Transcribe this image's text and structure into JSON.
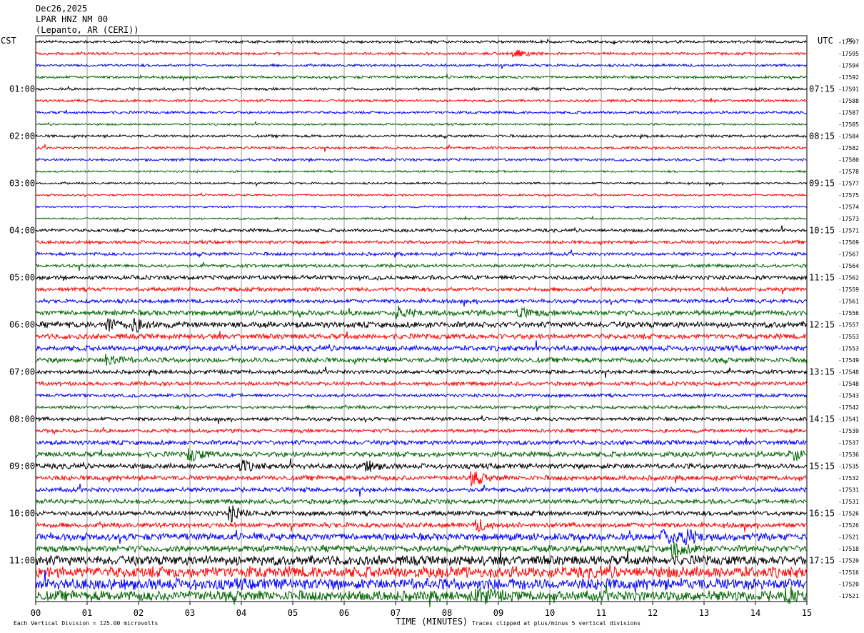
{
  "header": {
    "date": "Dec26,2025",
    "station": "LPAR HNZ NM 00",
    "location": "(Lepanto, AR (CERI))"
  },
  "left_zone": "CST",
  "right_zone": "UTC",
  "right_top_note": "DC",
  "footer": {
    "scale_note": "Each Vertical Division =  125.00 microvolts",
    "xlabel": "TIME (MINUTES)",
    "clip_note": "Traces clipped at plus/minus 5 vertical divisions"
  },
  "colors": [
    "#000000",
    "#ff0000",
    "#0000ff",
    "#006400"
  ],
  "chart_data": {
    "type": "line",
    "title": "",
    "xlabel": "TIME (MINUTES)",
    "x_ticks": [
      "00",
      "01",
      "02",
      "03",
      "04",
      "05",
      "06",
      "07",
      "08",
      "09",
      "10",
      "11",
      "12",
      "13",
      "14",
      "15"
    ],
    "xlim": [
      0,
      15
    ],
    "rows_per_hour": 4,
    "left_time_labels": [
      "01:00",
      "02:00",
      "03:00",
      "04:00",
      "05:00",
      "06:00",
      "07:00",
      "08:00",
      "09:00",
      "10:00",
      "11:00"
    ],
    "right_time_labels": [
      "07:15",
      "08:15",
      "09:15",
      "10:15",
      "11:15",
      "12:15",
      "13:15",
      "14:15",
      "15:15",
      "16:15",
      "17:15"
    ],
    "dc_offsets": [
      "-17597",
      "-17595",
      "-17594",
      "-17592",
      "-17591",
      "-17588",
      "-17587",
      "-17585",
      "-17584",
      "-17582",
      "-17580",
      "-17578",
      "-17577",
      "-17575",
      "-17574",
      "-17573",
      "-17571",
      "-17569",
      "-17567",
      "-17564",
      "-17562",
      "-17559",
      "-17561",
      "-17556",
      "-17557",
      "-17553",
      "-17553",
      "-17549",
      "-17548",
      "-17548",
      "-17543",
      "-17542",
      "-17541",
      "-17539",
      "-17537",
      "-17536",
      "-17535",
      "-17532",
      "-17531",
      "-17531",
      "-17526",
      "-17526",
      "-17521",
      "-17518",
      "-17520",
      "-17516",
      "-17520",
      "-17521"
    ],
    "trace_activity": [
      0.8,
      0.8,
      0.8,
      0.8,
      0.8,
      0.8,
      0.8,
      0.6,
      0.8,
      0.8,
      0.8,
      0.6,
      0.6,
      0.6,
      0.6,
      0.6,
      1,
      1,
      1,
      1,
      1.3,
      1.2,
      1.2,
      1.6,
      1.8,
      1.6,
      1.6,
      1.5,
      1.2,
      1.2,
      1,
      1,
      1.1,
      1.1,
      1.4,
      1.6,
      1.6,
      1.5,
      1.4,
      1.4,
      1.5,
      1.5,
      2.2,
      2,
      3,
      3.5,
      3.5,
      3.2
    ],
    "events": [
      {
        "trace": 1,
        "minute": 9.3,
        "amp": 3
      },
      {
        "trace": 23,
        "minute": 7.05,
        "amp": 4
      },
      {
        "trace": 23,
        "minute": 9.4,
        "amp": 4
      },
      {
        "trace": 24,
        "minute": 1.4,
        "amp": 5
      },
      {
        "trace": 24,
        "minute": 1.9,
        "amp": 5
      },
      {
        "trace": 27,
        "minute": 1.4,
        "amp": 5
      },
      {
        "trace": 35,
        "minute": 3.0,
        "amp": 5
      },
      {
        "trace": 35,
        "minute": 14.7,
        "amp": 5
      },
      {
        "trace": 36,
        "minute": 4.0,
        "amp": 4
      },
      {
        "trace": 36,
        "minute": 6.4,
        "amp": 4
      },
      {
        "trace": 37,
        "minute": 8.5,
        "amp": 5
      },
      {
        "trace": 40,
        "minute": 3.8,
        "amp": 5
      },
      {
        "trace": 41,
        "minute": 8.6,
        "amp": 4
      },
      {
        "trace": 42,
        "minute": 12.2,
        "amp": 6
      },
      {
        "trace": 42,
        "minute": 12.6,
        "amp": 6
      },
      {
        "trace": 43,
        "minute": 12.4,
        "amp": 6
      },
      {
        "trace": 47,
        "minute": 8.6,
        "amp": 6
      },
      {
        "trace": 47,
        "minute": 14.6,
        "amp": 6
      }
    ]
  }
}
